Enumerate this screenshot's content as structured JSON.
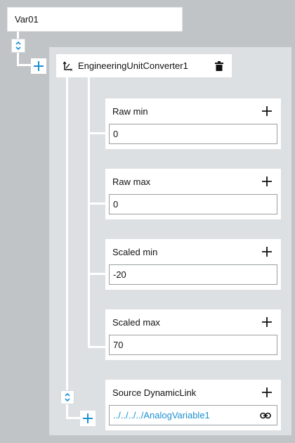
{
  "var_node": {
    "label": "Var01"
  },
  "converter": {
    "label": "EngineeringUnitConverter1"
  },
  "icons": {
    "collapse": "chevron-up-down-icon",
    "add_child": "plus-icon",
    "converter": "axis-function-icon",
    "delete": "trash-icon",
    "link": "link-icon"
  },
  "params": [
    {
      "label": "Raw min",
      "value": "0"
    },
    {
      "label": "Raw max",
      "value": "0"
    },
    {
      "label": "Scaled min",
      "value": "-20"
    },
    {
      "label": "Scaled max",
      "value": "70"
    }
  ],
  "source": {
    "label": "Source DynamicLink",
    "value": "../../../../AnalogVariable1"
  },
  "colors": {
    "accent": "#1a8fd3",
    "background": "#c1c4c7",
    "panel": "#dde0e3"
  }
}
